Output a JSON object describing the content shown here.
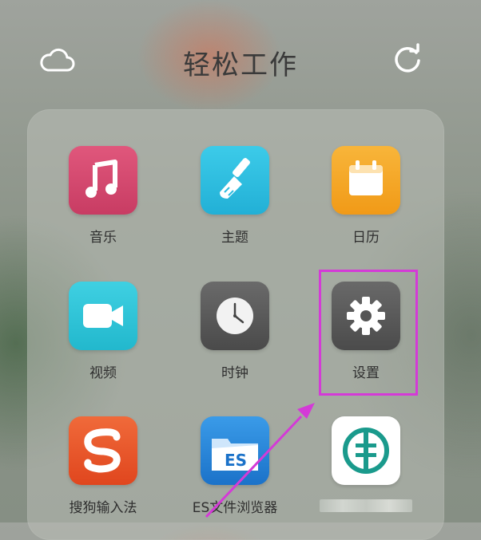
{
  "header": {
    "title": "轻松工作",
    "cloud_icon": "cloud-icon",
    "refresh_icon": "refresh-icon"
  },
  "apps": [
    {
      "label": "音乐",
      "icon": "music-icon",
      "color": "#d6476f"
    },
    {
      "label": "主题",
      "icon": "brush-icon",
      "color": "#2bbbe0"
    },
    {
      "label": "日历",
      "icon": "calendar-icon",
      "color": "#f5a623"
    },
    {
      "label": "视频",
      "icon": "video-camera-icon",
      "color": "#2cc3d8"
    },
    {
      "label": "时钟",
      "icon": "clock-icon",
      "color": "#555555"
    },
    {
      "label": "设置",
      "icon": "gear-icon",
      "color": "#5a5a5a"
    },
    {
      "label": "搜狗输入法",
      "icon": "sogou-icon",
      "color": "#e8542a"
    },
    {
      "label": "ES文件浏览器",
      "icon": "es-folder-icon",
      "color": "#1e88e5"
    },
    {
      "label": "",
      "icon": "bank-logo-icon",
      "color": "#1a9a8c"
    }
  ],
  "annotation": {
    "highlight_color": "#d43ad7",
    "highlighted_app": "设置"
  }
}
